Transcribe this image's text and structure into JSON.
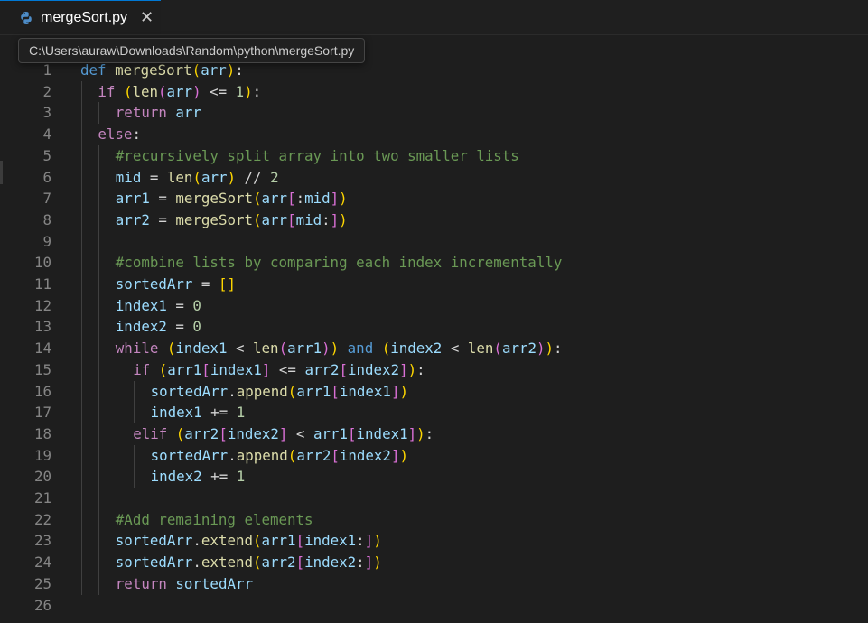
{
  "tab": {
    "filename": "mergeSort.py",
    "close_glyph": "✕",
    "icon": "python-icon"
  },
  "tooltip": {
    "path": "C:\\Users\\auraw\\Downloads\\Random\\python\\mergeSort.py"
  },
  "colors": {
    "background": "#1e1e1e",
    "keyword": "#569cd6",
    "control": "#c586c0",
    "function": "#dcdcaa",
    "variable": "#9cdcfe",
    "number": "#b5cea8",
    "comment": "#6a9955",
    "line_number": "#858585",
    "bracket_1": "#ffd700",
    "bracket_2": "#da70d6",
    "bracket_3": "#179fff"
  },
  "lines": [
    {
      "n": "1",
      "indent": 0,
      "tokens": [
        [
          "kw",
          "def"
        ],
        [
          "op",
          " "
        ],
        [
          "fn",
          "mergeSort"
        ],
        [
          "p1",
          "("
        ],
        [
          "var",
          "arr"
        ],
        [
          "p1",
          ")"
        ],
        [
          "op",
          ":"
        ]
      ]
    },
    {
      "n": "2",
      "indent": 1,
      "tokens": [
        [
          "ctl",
          "if"
        ],
        [
          "op",
          " "
        ],
        [
          "p1",
          "("
        ],
        [
          "fn",
          "len"
        ],
        [
          "p2",
          "("
        ],
        [
          "var",
          "arr"
        ],
        [
          "p2",
          ")"
        ],
        [
          "op",
          " <= "
        ],
        [
          "num",
          "1"
        ],
        [
          "p1",
          ")"
        ],
        [
          "op",
          ":"
        ]
      ]
    },
    {
      "n": "3",
      "indent": 2,
      "tokens": [
        [
          "ctl",
          "return"
        ],
        [
          "op",
          " "
        ],
        [
          "var",
          "arr"
        ]
      ]
    },
    {
      "n": "4",
      "indent": 1,
      "tokens": [
        [
          "ctl",
          "else"
        ],
        [
          "op",
          ":"
        ]
      ]
    },
    {
      "n": "5",
      "indent": 2,
      "tokens": [
        [
          "cm",
          "#recursively split array into two smaller lists"
        ]
      ]
    },
    {
      "n": "6",
      "indent": 2,
      "tokens": [
        [
          "var",
          "mid"
        ],
        [
          "op",
          " = "
        ],
        [
          "fn",
          "len"
        ],
        [
          "p1",
          "("
        ],
        [
          "var",
          "arr"
        ],
        [
          "p1",
          ")"
        ],
        [
          "op",
          " // "
        ],
        [
          "num",
          "2"
        ]
      ]
    },
    {
      "n": "7",
      "indent": 2,
      "tokens": [
        [
          "var",
          "arr1"
        ],
        [
          "op",
          " = "
        ],
        [
          "fn",
          "mergeSort"
        ],
        [
          "p1",
          "("
        ],
        [
          "var",
          "arr"
        ],
        [
          "p2",
          "["
        ],
        [
          "op",
          ":"
        ],
        [
          "var",
          "mid"
        ],
        [
          "p2",
          "]"
        ],
        [
          "p1",
          ")"
        ]
      ]
    },
    {
      "n": "8",
      "indent": 2,
      "tokens": [
        [
          "var",
          "arr2"
        ],
        [
          "op",
          " = "
        ],
        [
          "fn",
          "mergeSort"
        ],
        [
          "p1",
          "("
        ],
        [
          "var",
          "arr"
        ],
        [
          "p2",
          "["
        ],
        [
          "var",
          "mid"
        ],
        [
          "op",
          ":"
        ],
        [
          "p2",
          "]"
        ],
        [
          "p1",
          ")"
        ]
      ]
    },
    {
      "n": "9",
      "indent": 2,
      "tokens": []
    },
    {
      "n": "10",
      "indent": 2,
      "tokens": [
        [
          "cm",
          "#combine lists by comparing each index incrementally"
        ]
      ]
    },
    {
      "n": "11",
      "indent": 2,
      "tokens": [
        [
          "var",
          "sortedArr"
        ],
        [
          "op",
          " = "
        ],
        [
          "p1",
          "[]"
        ]
      ]
    },
    {
      "n": "12",
      "indent": 2,
      "tokens": [
        [
          "var",
          "index1"
        ],
        [
          "op",
          " = "
        ],
        [
          "num",
          "0"
        ]
      ]
    },
    {
      "n": "13",
      "indent": 2,
      "tokens": [
        [
          "var",
          "index2"
        ],
        [
          "op",
          " = "
        ],
        [
          "num",
          "0"
        ]
      ]
    },
    {
      "n": "14",
      "indent": 2,
      "tokens": [
        [
          "ctl",
          "while"
        ],
        [
          "op",
          " "
        ],
        [
          "p1",
          "("
        ],
        [
          "var",
          "index1"
        ],
        [
          "op",
          " < "
        ],
        [
          "fn",
          "len"
        ],
        [
          "p2",
          "("
        ],
        [
          "var",
          "arr1"
        ],
        [
          "p2",
          ")"
        ],
        [
          "p1",
          ")"
        ],
        [
          "op",
          " "
        ],
        [
          "kw",
          "and"
        ],
        [
          "op",
          " "
        ],
        [
          "p1",
          "("
        ],
        [
          "var",
          "index2"
        ],
        [
          "op",
          " < "
        ],
        [
          "fn",
          "len"
        ],
        [
          "p2",
          "("
        ],
        [
          "var",
          "arr2"
        ],
        [
          "p2",
          ")"
        ],
        [
          "p1",
          ")"
        ],
        [
          "op",
          ":"
        ]
      ]
    },
    {
      "n": "15",
      "indent": 3,
      "tokens": [
        [
          "ctl",
          "if"
        ],
        [
          "op",
          " "
        ],
        [
          "p1",
          "("
        ],
        [
          "var",
          "arr1"
        ],
        [
          "p2",
          "["
        ],
        [
          "var",
          "index1"
        ],
        [
          "p2",
          "]"
        ],
        [
          "op",
          " <= "
        ],
        [
          "var",
          "arr2"
        ],
        [
          "p2",
          "["
        ],
        [
          "var",
          "index2"
        ],
        [
          "p2",
          "]"
        ],
        [
          "p1",
          ")"
        ],
        [
          "op",
          ":"
        ]
      ]
    },
    {
      "n": "16",
      "indent": 4,
      "tokens": [
        [
          "var",
          "sortedArr"
        ],
        [
          "op",
          "."
        ],
        [
          "fn",
          "append"
        ],
        [
          "p1",
          "("
        ],
        [
          "var",
          "arr1"
        ],
        [
          "p2",
          "["
        ],
        [
          "var",
          "index1"
        ],
        [
          "p2",
          "]"
        ],
        [
          "p1",
          ")"
        ]
      ]
    },
    {
      "n": "17",
      "indent": 4,
      "tokens": [
        [
          "var",
          "index1"
        ],
        [
          "op",
          " += "
        ],
        [
          "num",
          "1"
        ]
      ]
    },
    {
      "n": "18",
      "indent": 3,
      "tokens": [
        [
          "ctl",
          "elif"
        ],
        [
          "op",
          " "
        ],
        [
          "p1",
          "("
        ],
        [
          "var",
          "arr2"
        ],
        [
          "p2",
          "["
        ],
        [
          "var",
          "index2"
        ],
        [
          "p2",
          "]"
        ],
        [
          "op",
          " < "
        ],
        [
          "var",
          "arr1"
        ],
        [
          "p2",
          "["
        ],
        [
          "var",
          "index1"
        ],
        [
          "p2",
          "]"
        ],
        [
          "p1",
          ")"
        ],
        [
          "op",
          ":"
        ]
      ]
    },
    {
      "n": "19",
      "indent": 4,
      "tokens": [
        [
          "var",
          "sortedArr"
        ],
        [
          "op",
          "."
        ],
        [
          "fn",
          "append"
        ],
        [
          "p1",
          "("
        ],
        [
          "var",
          "arr2"
        ],
        [
          "p2",
          "["
        ],
        [
          "var",
          "index2"
        ],
        [
          "p2",
          "]"
        ],
        [
          "p1",
          ")"
        ]
      ]
    },
    {
      "n": "20",
      "indent": 4,
      "tokens": [
        [
          "var",
          "index2"
        ],
        [
          "op",
          " += "
        ],
        [
          "num",
          "1"
        ]
      ]
    },
    {
      "n": "21",
      "indent": 2,
      "tokens": []
    },
    {
      "n": "22",
      "indent": 2,
      "tokens": [
        [
          "cm",
          "#Add remaining elements"
        ]
      ]
    },
    {
      "n": "23",
      "indent": 2,
      "tokens": [
        [
          "var",
          "sortedArr"
        ],
        [
          "op",
          "."
        ],
        [
          "fn",
          "extend"
        ],
        [
          "p1",
          "("
        ],
        [
          "var",
          "arr1"
        ],
        [
          "p2",
          "["
        ],
        [
          "var",
          "index1"
        ],
        [
          "op",
          ":"
        ],
        [
          "p2",
          "]"
        ],
        [
          "p1",
          ")"
        ]
      ]
    },
    {
      "n": "24",
      "indent": 2,
      "tokens": [
        [
          "var",
          "sortedArr"
        ],
        [
          "op",
          "."
        ],
        [
          "fn",
          "extend"
        ],
        [
          "p1",
          "("
        ],
        [
          "var",
          "arr2"
        ],
        [
          "p2",
          "["
        ],
        [
          "var",
          "index2"
        ],
        [
          "op",
          ":"
        ],
        [
          "p2",
          "]"
        ],
        [
          "p1",
          ")"
        ]
      ]
    },
    {
      "n": "25",
      "indent": 2,
      "tokens": [
        [
          "ctl",
          "return"
        ],
        [
          "op",
          " "
        ],
        [
          "var",
          "sortedArr"
        ]
      ]
    },
    {
      "n": "26",
      "indent": 0,
      "tokens": []
    }
  ]
}
